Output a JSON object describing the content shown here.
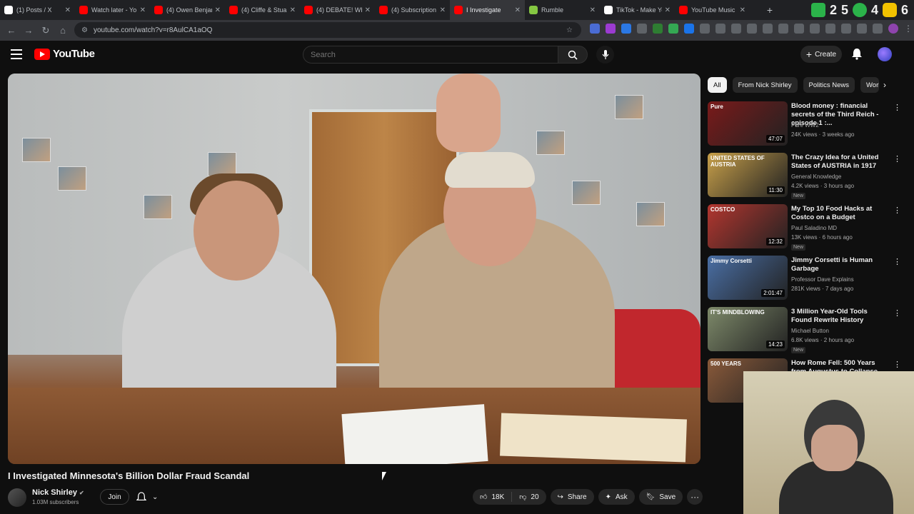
{
  "browser": {
    "tabs": [
      {
        "label": "(1) Posts / X",
        "icon": "x-icon",
        "color": "#ffffff"
      },
      {
        "label": "Watch later - Yo",
        "icon": "youtube-icon",
        "color": "#ff0000"
      },
      {
        "label": "(4) Owen Benjan",
        "icon": "youtube-icon",
        "color": "#ff0000"
      },
      {
        "label": "(4) Cliffe & Stua",
        "icon": "youtube-icon",
        "color": "#ff0000"
      },
      {
        "label": "(4) DEBATE! Wh",
        "icon": "youtube-icon",
        "color": "#ff0000"
      },
      {
        "label": "(4) Subscription",
        "icon": "youtube-icon",
        "color": "#ff0000"
      },
      {
        "label": "I Investigate",
        "icon": "youtube-icon",
        "color": "#ff0000"
      },
      {
        "label": "Rumble",
        "icon": "rumble-icon",
        "color": "#85c742"
      },
      {
        "label": "TikTok - Make Yo",
        "icon": "tiktok-icon",
        "color": "#ffffff"
      },
      {
        "label": "YouTube Music",
        "icon": "youtube-music-icon",
        "color": "#ff0000"
      }
    ],
    "active_tab_index": 6,
    "url": "youtube.com/watch?v=r8AulCA1aOQ",
    "overlay_digits": [
      "2",
      "5",
      "4",
      "6"
    ]
  },
  "youtube": {
    "logo_text": "YouTube",
    "search_placeholder": "Search",
    "create_label": "Create"
  },
  "video": {
    "title": "I Investigated Minnesota's Billion Dollar Fraud Scandal",
    "channel_name": "Nick Shirley",
    "subscribers": "1.03M subscribers",
    "join_label": "Join",
    "likes": "18K",
    "dislikes": "20",
    "share_label": "Share",
    "ask_label": "Ask",
    "save_label": "Save"
  },
  "chips": [
    "All",
    "From Nick Shirley",
    "Politics News",
    "Worl"
  ],
  "recommendations": [
    {
      "title": "Blood money : financial secrets of the Third Reich - episode 1 :...",
      "channel": "Pure WW2",
      "meta": "24K views · 3 weeks ago",
      "duration": "47:07",
      "new": "",
      "thumb_text": "Pure",
      "thumb_color": "#7a1a1a"
    },
    {
      "title": "The Crazy Idea for a United States of AUSTRIA in 1917",
      "channel": "General Knowledge",
      "meta": "4.2K views · 3 hours ago",
      "duration": "11:30",
      "new": "New",
      "thumb_text": "UNITED STATES OF AUSTRIA",
      "thumb_color": "#c8a04a"
    },
    {
      "title": "My Top 10 Food Hacks at Costco on a Budget",
      "channel": "Paul Saladino MD",
      "meta": "13K views · 6 hours ago",
      "duration": "12:32",
      "new": "New",
      "thumb_text": "COSTCO",
      "thumb_color": "#b3362f"
    },
    {
      "title": "Jimmy Corsetti is Human Garbage",
      "channel": "Professor Dave Explains",
      "meta": "281K views · 7 days ago",
      "duration": "2:01:47",
      "new": "",
      "thumb_text": "Jimmy Corsetti",
      "thumb_color": "#4a6fa5"
    },
    {
      "title": "3 Million Year-Old Tools Found Rewrite History",
      "channel": "Michael Button",
      "meta": "6.8K views · 2 hours ago",
      "duration": "14:23",
      "new": "New",
      "thumb_text": "IT'S MINDBLOWING",
      "thumb_color": "#7e8a6a"
    },
    {
      "title": "How Rome Fell: 500 Years from Augustus to Collapse",
      "channel": "",
      "meta": "",
      "duration": "",
      "new": "",
      "thumb_text": "500 YEARS",
      "thumb_color": "#8a5a3a"
    }
  ]
}
